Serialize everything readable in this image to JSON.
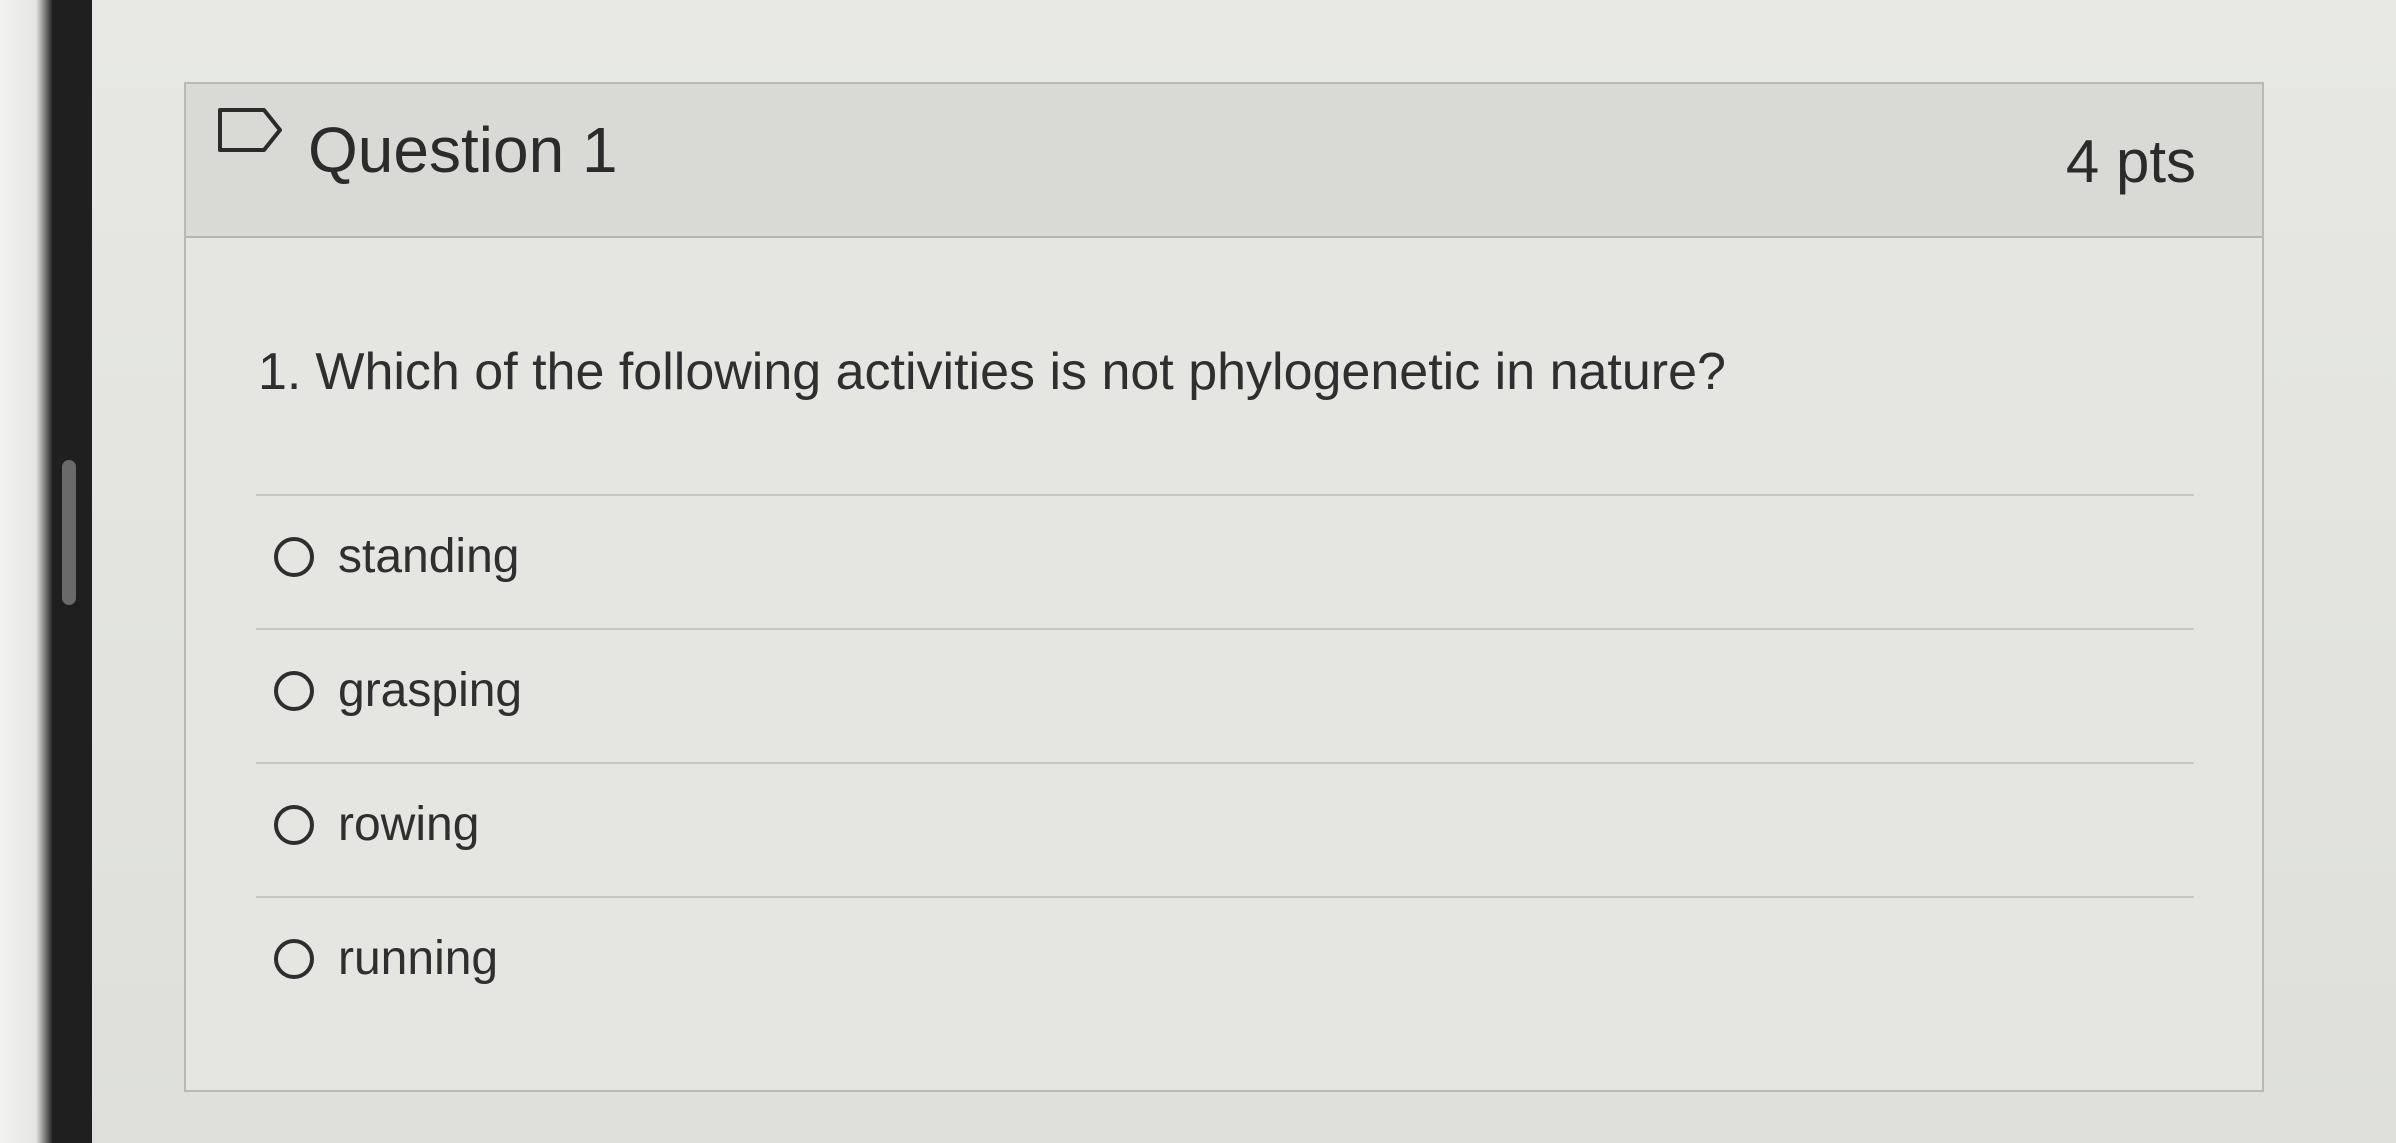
{
  "question": {
    "title": "Question 1",
    "points": "4 pts",
    "number": "1.",
    "text": "Which of the following activities is not phylogenetic in nature?",
    "flag_icon": "flag-icon"
  },
  "answers": [
    {
      "label": "standing",
      "selected": false
    },
    {
      "label": "grasping",
      "selected": false
    },
    {
      "label": "rowing",
      "selected": false
    },
    {
      "label": "running",
      "selected": false
    }
  ],
  "colors": {
    "header_bg": "#d9dad6",
    "body_bg": "#e5e6e2",
    "text": "#2b2b2b",
    "border": "#b8b9b5"
  }
}
